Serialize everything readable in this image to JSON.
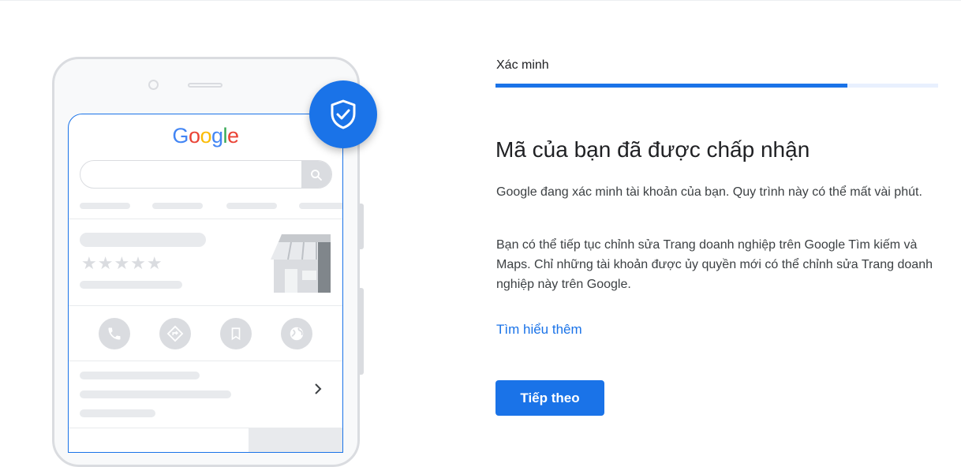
{
  "illustration": {
    "logo_letters": [
      {
        "ch": "G",
        "color": "#4285F4"
      },
      {
        "ch": "o",
        "color": "#EA4335"
      },
      {
        "ch": "o",
        "color": "#FBBC05"
      },
      {
        "ch": "g",
        "color": "#4285F4"
      },
      {
        "ch": "l",
        "color": "#34A853"
      },
      {
        "ch": "e",
        "color": "#EA4335"
      }
    ],
    "stars": "★★★★★",
    "badge_icon": "shield-check-icon",
    "action_icons": [
      "phone-icon",
      "directions-icon",
      "bookmark-icon",
      "globe-icon"
    ]
  },
  "step": {
    "label": "Xác minh",
    "progress": 0.795
  },
  "main": {
    "title": "Mã của bạn đã được chấp nhận",
    "paragraph1": "Google đang xác minh tài khoản của bạn. Quy trình này có thể mất vài phút.",
    "paragraph2": "Bạn có thể tiếp tục chỉnh sửa Trang doanh nghiệp trên Google Tìm kiếm và Maps. Chỉ những tài khoản được ủy quyền mới có thể chỉnh sửa Trang doanh nghiệp này trên Google.",
    "learn_more": "Tìm hiểu thêm",
    "next_button": "Tiếp theo"
  },
  "colors": {
    "accent": "#1a73e8",
    "placeholder_gray": "#dadce0"
  }
}
